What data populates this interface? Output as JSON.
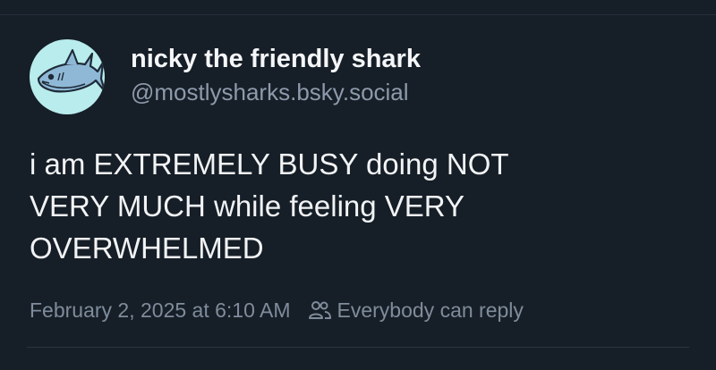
{
  "author": {
    "display_name": "nicky the friendly shark",
    "handle": "@mostlysharks.bsky.social",
    "avatar_icon": "shark-avatar-icon"
  },
  "post": {
    "text_lines": [
      "i am EXTREMELY BUSY doing NOT",
      "VERY MUCH while feeling VERY",
      "OVERWHELMED"
    ],
    "timestamp": "February 2, 2025 at 6:10 AM",
    "reply_setting": "Everybody can reply",
    "reply_icon": "people-icon"
  },
  "colors": {
    "background": "#161e27",
    "text": "#f1f3f5",
    "muted": "#8d9aab",
    "avatar_bg": "#b9ecec"
  }
}
